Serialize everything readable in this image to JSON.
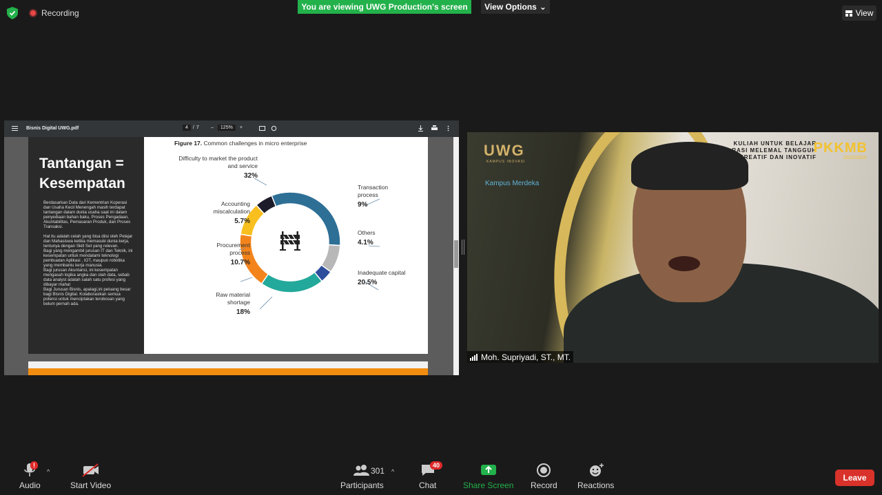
{
  "top": {
    "recording_label": "Recording",
    "viewing_banner": "You are viewing UWG Production's screen",
    "view_options": "View Options",
    "view_button": "View"
  },
  "pdf": {
    "file_name": "Bisnis Digital UWG.pdf",
    "page_current": "4",
    "page_sep": "/",
    "page_total": "7",
    "zoom": "125%",
    "minus": "–",
    "plus": "+"
  },
  "slide": {
    "title": "Tantangan = Kesempatan",
    "body": "Berdasarkan Data dari Kementrian Koperasi dan Usaha Kecil Menengah masih terdapat tantangan dalam dunia usaha saat ini dalam penyediaan bahan baku, Proses Pengadaan, Akuntabilitas, Pemasaran Produk, dan Proses Transaksi.\n\nHal itu adalah celah yang bisa diisi oleh Pelajar dan Mahasiswa ketika memasuki dunia kerja, tentunya dengan Skill Set yang relevan.\nBagi yang mengambil jurusan IT dan Teknik, ini kesempatan untuk mendalami teknologi pembuatan Aplikasi , IOT, maupun robotika yang membantu kerja manusia\nBagi jurusan Akuntansi, ini kesempatan mengasah logika angka dan olah data, sebab data analyst adalah salah satu profesi yang dibayar mahal\nBagi Jurusan Bisnis, apalagi,ini peluang besar bagi Bisnis Digital. Kolaborasikan semua potensi untuk menciptakan terobosan yang belum pernah ada.",
    "figure_label": "Figure 17.",
    "figure_caption": "Common challenges in micro enterprise"
  },
  "chart_data": {
    "type": "pie",
    "title": "Common challenges in micro enterprise",
    "categories": [
      "Difficulty to market the product and service",
      "Transaction process",
      "Others",
      "Inadequate capital",
      "Raw material shortage",
      "Procurement process",
      "Accounting miscalculation"
    ],
    "values": [
      32,
      9,
      4.1,
      20.5,
      18,
      10.7,
      5.7
    ],
    "value_labels": [
      "32%",
      "9%",
      "4.1%",
      "20.5%",
      "18%",
      "10.7%",
      "5.7%"
    ],
    "colors": [
      "#2e6f96",
      "#b8b8b8",
      "#2c4e9c",
      "#23a99b",
      "#f3841c",
      "#f8bf1e",
      "#1c1c2a"
    ]
  },
  "video": {
    "participant_name": "Moh. Supriyadi, ST., MT.",
    "logo_text": "UWG",
    "logo_sub": "KAMPUS INOVASI",
    "kampus_text": "Kampus Merdeka",
    "banner_text": "KULIAH UNTUK BELAJAR\nRASI MELEMAL TANGGUH\nKREATIF DAN INOVATIF",
    "event_logo": "PKKMB",
    "event_year": "2022/2023"
  },
  "toolbar": {
    "audio": "Audio",
    "audio_badge": "!",
    "start_video": "Start Video",
    "participants": "Participants",
    "participants_count": "301",
    "chat": "Chat",
    "chat_badge": "40",
    "share_screen": "Share Screen",
    "record": "Record",
    "reactions": "Reactions",
    "leave": "Leave"
  }
}
